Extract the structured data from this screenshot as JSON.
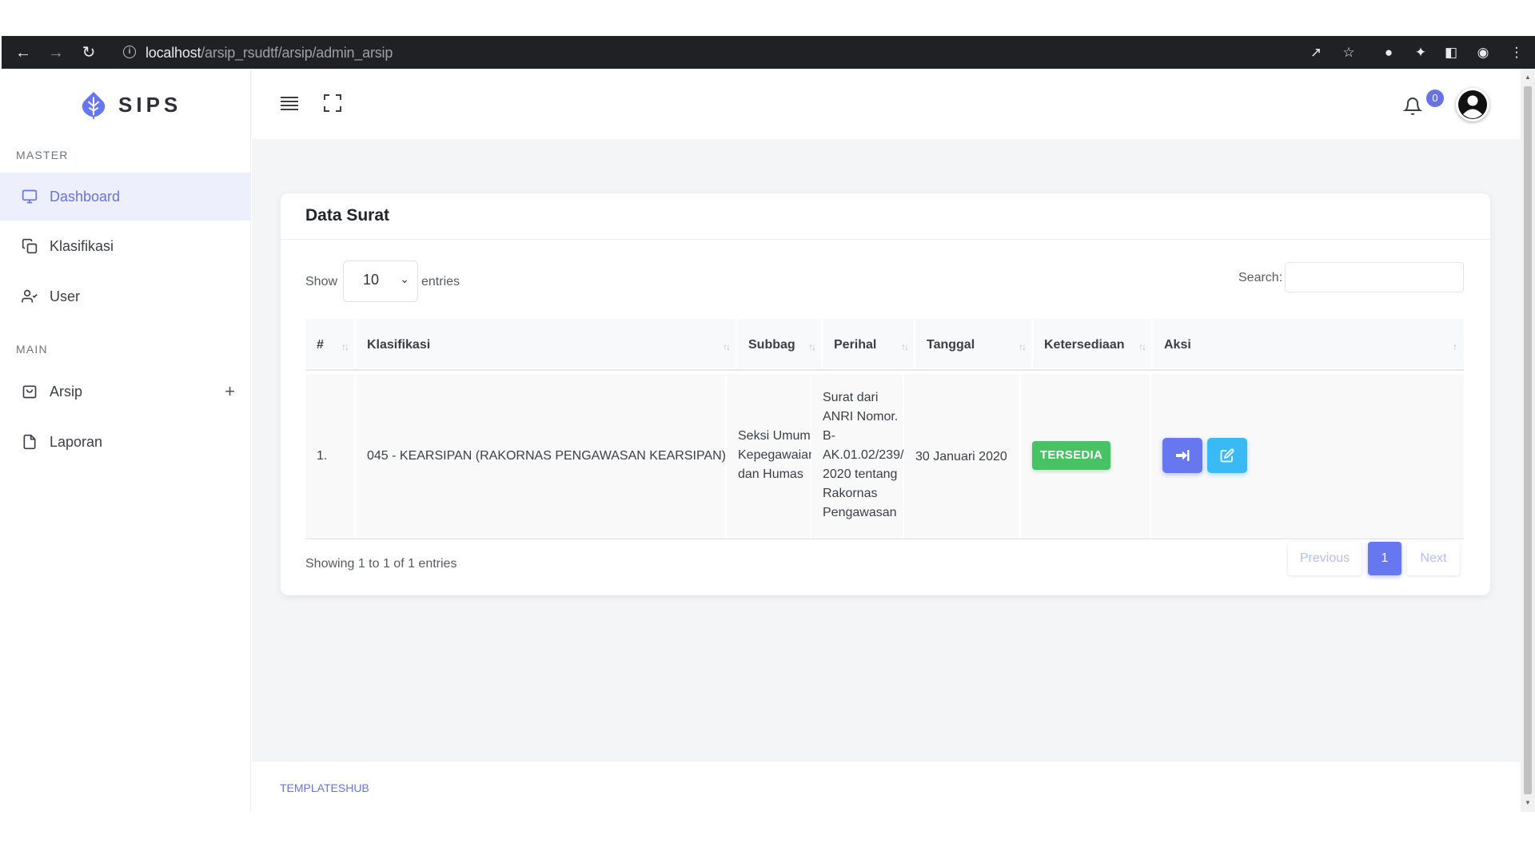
{
  "browser": {
    "url_host": "localhost",
    "url_path": "/arsip_rsudtf/arsip/admin_arsip"
  },
  "sidebar": {
    "brand": "SIPS",
    "sections": [
      {
        "header": "MASTER",
        "items": [
          {
            "label": "Dashboard",
            "icon": "monitor-icon",
            "active": true
          },
          {
            "label": "Klasifikasi",
            "icon": "copy-icon"
          },
          {
            "label": "User",
            "icon": "user-check-icon"
          }
        ]
      },
      {
        "header": "MAIN",
        "items": [
          {
            "label": "Arsip",
            "icon": "archive-icon",
            "expand": "+"
          },
          {
            "label": "Laporan",
            "icon": "file-icon"
          }
        ]
      }
    ]
  },
  "topbar": {
    "notification_count": "0"
  },
  "card": {
    "title": "Data Surat",
    "length": {
      "show": "Show",
      "value": "10",
      "entries": "entries"
    },
    "search_label": "Search:",
    "search_value": "",
    "columns": [
      "#",
      "Klasifikasi",
      "Subbag",
      "Perihal",
      "Tanggal",
      "Ketersediaan",
      "Aksi"
    ],
    "rows": [
      {
        "no": "1.",
        "klasifikasi": "045 - KEARSIPAN (RAKORNAS PENGAWASAN KEARSIPAN)",
        "subbag": [
          "Seksi Umum,",
          "Kepegawaian",
          "dan Humas"
        ],
        "perihal": [
          "Surat dari",
          "ANRI Nomor.",
          "B-",
          "AK.01.02/239/",
          "2020 tentang",
          "Rakornas",
          "Pengawasan"
        ],
        "tanggal": "30 Januari 2020",
        "ketersediaan": "TERSEDIA"
      }
    ],
    "info": "Showing 1 to 1 of 1 entries",
    "pagination": {
      "previous": "Previous",
      "current": "1",
      "next": "Next"
    }
  },
  "footer": {
    "text": "TEMPLATESHUB"
  },
  "colors": {
    "primary": "#6777ef",
    "info": "#3abaf4",
    "success": "#47c363"
  }
}
